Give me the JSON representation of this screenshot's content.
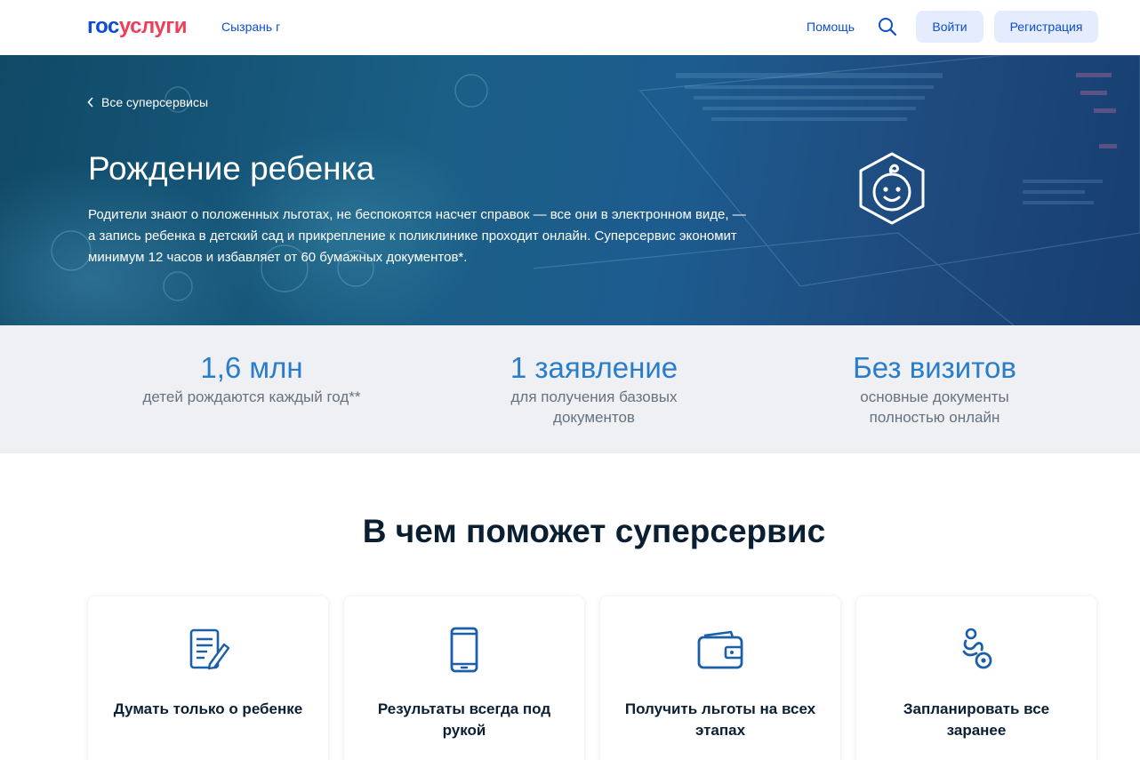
{
  "header": {
    "logo_part1": "гос",
    "logo_part2": "услуги",
    "city": "Сызрань г",
    "help_label": "Помощь",
    "search_icon": "search-icon",
    "login_label": "Войти",
    "register_label": "Регистрация"
  },
  "hero": {
    "back_label": "Все суперсервисы",
    "title": "Рождение ребенка",
    "description": "Родители знают о положенных льготах, не беспокоятся насчет справок — все они в электронном виде, — а запись ребенка в детский сад и прикрепление к поликлинике проходит онлайн. Суперсервис экономит минимум 12 часов и избавляет от 60 бумажных документов*.",
    "icon": "baby-icon"
  },
  "stats": [
    {
      "value": "1,6 млн",
      "label": "детей рождаются каждый год**"
    },
    {
      "value": "1 заявление",
      "label": "для получения базовых документов"
    },
    {
      "value": "Без визитов",
      "label": "основные документы полностью онлайн"
    }
  ],
  "section": {
    "title": "В чем поможет суперсервис"
  },
  "cards": [
    {
      "label": "Думать только о ребенке",
      "icon": "document-pen-icon"
    },
    {
      "label": "Результаты всегда под рукой",
      "icon": "smartphone-icon"
    },
    {
      "label": "Получить льготы на всех этапах",
      "icon": "wallet-icon"
    },
    {
      "label": "Запланировать все заранее",
      "icon": "pacifier-icon"
    }
  ],
  "colors": {
    "brand_blue": "#0d4cd3",
    "brand_red": "#ee3f58",
    "stat_blue": "#2a7dc9",
    "icon_blue": "#1a5fa8"
  }
}
